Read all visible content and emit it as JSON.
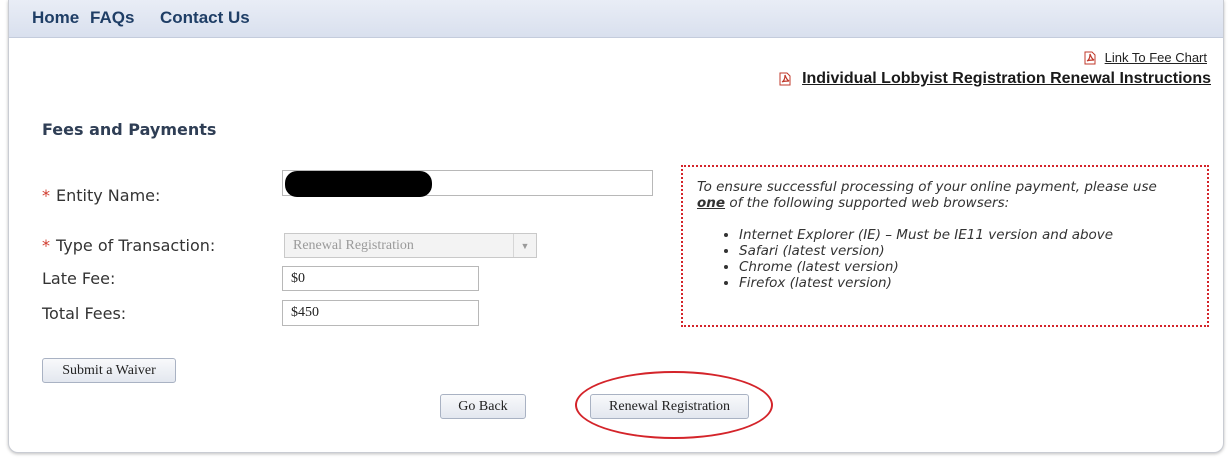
{
  "nav": {
    "home": "Home",
    "faqs": "FAQs",
    "contact": "Contact Us"
  },
  "links": {
    "fee_chart": "Link To Fee Chart",
    "instructions": "Individual Lobbyist Registration Renewal Instructions"
  },
  "section_title": "Fees and Payments",
  "form": {
    "required_mark": "*",
    "entity_name_label": "Entity Name:",
    "entity_name_value": "",
    "transaction_label": "Type of Transaction:",
    "transaction_value": "Renewal Registration",
    "late_fee_label": "Late Fee:",
    "late_fee_value": "$0",
    "total_fees_label": "Total Fees:",
    "total_fees_value": "$450"
  },
  "notice": {
    "intro_before": "To ensure successful processing of your online payment, please use ",
    "intro_emphasis": "one",
    "intro_after": " of the following supported web browsers:",
    "browsers": [
      "Internet Explorer (IE) – Must be IE11 version and above",
      "Safari (latest version)",
      "Chrome (latest version)",
      "Firefox (latest version)"
    ]
  },
  "buttons": {
    "submit_waiver": "Submit a Waiver",
    "go_back": "Go Back",
    "renewal_registration": "Renewal Registration"
  },
  "colors": {
    "nav_text": "#1f3e66",
    "required": "#d0392b",
    "highlight": "#d4242a"
  },
  "icons": [
    "pdf-icon",
    "pdf-icon",
    "chevron-down-icon"
  ]
}
